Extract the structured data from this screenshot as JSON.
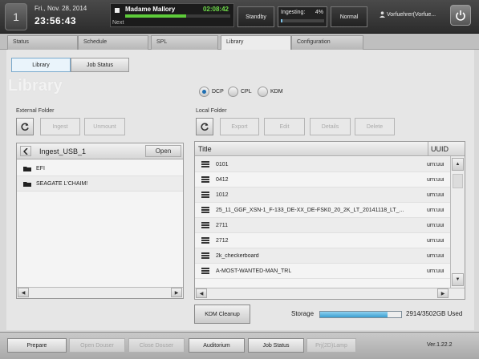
{
  "top": {
    "screen_number": "1",
    "date": "Fri., Nov. 28, 2014",
    "clock": "23:56:43",
    "show_title": "Madame Mallory",
    "show_time": "02:08:42",
    "show_progress": 0.58,
    "show_next": "Next",
    "standby": "Standby",
    "ingesting_label": "Ingesting:",
    "ingesting_pct": "4%",
    "ingesting_progress": 0.04,
    "normal": "Normal",
    "user": "Vorfuehrer(Vorfue..."
  },
  "tabs": [
    "Status",
    "Schedule",
    "SPL",
    "Library",
    "Configuration"
  ],
  "subtabs": {
    "library": "Library",
    "job_status": "Job Status"
  },
  "watermark": "Library",
  "radios": [
    "DCP",
    "CPL",
    "KDM"
  ],
  "external": {
    "label": "External Folder",
    "ingest": "Ingest",
    "unmount": "Unmount",
    "path": "Ingest_USB_1",
    "open": "Open",
    "folders": [
      "EFI",
      "SEAGATE L'CHAIM!"
    ]
  },
  "local": {
    "label": "Local Folder",
    "export": "Export",
    "edit": "Edit",
    "details": "Details",
    "delete": "Delete",
    "col_title": "Title",
    "col_uuid": "UUID",
    "rows": [
      {
        "title": "0101",
        "uuid": "urn:uui"
      },
      {
        "title": "0412",
        "uuid": "urn:uui"
      },
      {
        "title": "1012",
        "uuid": "urn:uui"
      },
      {
        "title": "25_11_GGF_XSN-1_F-133_DE-XX_DE-FSK0_20_2K_LT_20141118_LT_...",
        "uuid": "urn:uui"
      },
      {
        "title": "2711",
        "uuid": "urn:uui"
      },
      {
        "title": "2712",
        "uuid": "urn:uui"
      },
      {
        "title": "2k_checkerboard",
        "uuid": "urn:uui"
      },
      {
        "title": "A-MOST-WANTED-MAN_TRL",
        "uuid": "urn:uui"
      }
    ]
  },
  "kdm_cleanup": "KDM Cleanup",
  "storage": {
    "label": "Storage",
    "value": "2914/3502GB Used",
    "used_fraction": 0.832
  },
  "bottom": {
    "prepare": "Prepare",
    "open_douser": "Open Douser",
    "close_douser": "Close Douser",
    "auditorium": "Auditorium",
    "job_status": "Job Status",
    "prj_lamp": "Prj(2D)Lamp",
    "version": "Ver.1.22.2"
  },
  "colors": {
    "accent": "#1f6fb2",
    "green": "#5ecb3a",
    "storage": "#3b9fd1"
  }
}
